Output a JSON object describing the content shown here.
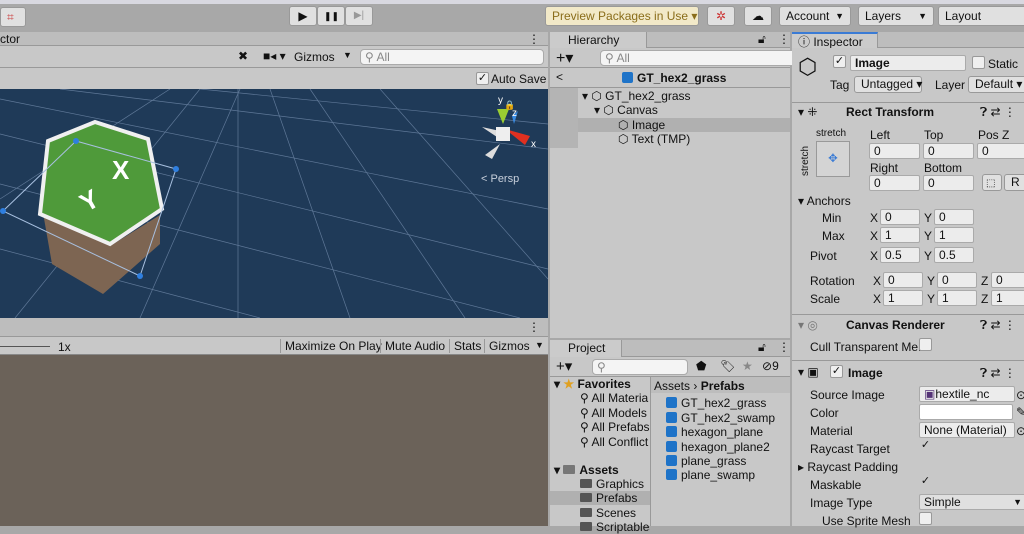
{
  "toolbar": {
    "preview_packages": "Preview Packages in Use ▾",
    "account": "Account",
    "layers": "Layers",
    "layout": "Layout",
    "play": "▶",
    "pause": "❚❚",
    "step": "▶|"
  },
  "scene": {
    "tab": "ctor",
    "gizmos": "Gizmos",
    "search_placeholder": "All",
    "auto_save": "Auto Save",
    "persp": "< Persp",
    "axis_x": "x",
    "axis_y": "y",
    "axis_z": "z"
  },
  "game": {
    "scale": "1x",
    "maximize": "Maximize On Play",
    "mute": "Mute Audio",
    "stats": "Stats",
    "gizmos": "Gizmos"
  },
  "hierarchy": {
    "tab": "Hierarchy",
    "search_placeholder": "All",
    "prefab_header": "GT_hex2_grass",
    "items": [
      {
        "label": "GT_hex2_grass"
      },
      {
        "label": "Canvas"
      },
      {
        "label": "Image"
      },
      {
        "label": "Text (TMP)"
      }
    ]
  },
  "project": {
    "tab": "Project",
    "hidden_count": "9",
    "favorites": "Favorites",
    "fav_items": [
      "All Materia",
      "All Models",
      "All Prefabs",
      "All Conflict"
    ],
    "assets": "Assets",
    "folders": [
      "Graphics",
      "Prefabs",
      "Scenes",
      "Scriptables"
    ],
    "breadcrumb_root": "Assets",
    "breadcrumb_current": "Prefabs",
    "files": [
      "GT_hex2_grass",
      "GT_hex2_swamp",
      "hexagon_plane",
      "hexagon_plane2",
      "plane_grass",
      "plane_swamp"
    ]
  },
  "inspector": {
    "tab": "Inspector",
    "name": "Image",
    "static": "Static",
    "tag_label": "Tag",
    "tag": "Untagged",
    "layer_label": "Layer",
    "layer": "Default",
    "rect": {
      "title": "Rect Transform",
      "stretch": "stretch",
      "left_label": "Left",
      "top_label": "Top",
      "posz_label": "Pos Z",
      "left": "0",
      "top": "0",
      "posz": "0",
      "right_label": "Right",
      "bottom_label": "Bottom",
      "right": "0",
      "bottom": "0",
      "r": "R",
      "anchors": "Anchors",
      "min": "Min",
      "max": "Max",
      "min_x": "0",
      "min_y": "0",
      "max_x": "1",
      "max_y": "1",
      "pivot": "Pivot",
      "pivot_x": "0.5",
      "pivot_y": "0.5",
      "rotation": "Rotation",
      "rot_x": "0",
      "rot_y": "0",
      "rot_z": "0",
      "scale": "Scale",
      "scale_x": "1",
      "scale_y": "1",
      "scale_z": "1",
      "x": "X",
      "y": "Y",
      "z": "Z"
    },
    "canvas_renderer": {
      "title": "Canvas Renderer",
      "cull": "Cull Transparent Me:"
    },
    "image": {
      "title": "Image",
      "source_label": "Source Image",
      "source": "hextile_nc",
      "color_label": "Color",
      "material_label": "Material",
      "material": "None (Material)",
      "raycast_target": "Raycast Target",
      "raycast_padding": "Raycast Padding",
      "maskable": "Maskable",
      "image_type_label": "Image Type",
      "image_type": "Simple",
      "use_sprite_mesh": "Use Sprite Mesh"
    }
  }
}
